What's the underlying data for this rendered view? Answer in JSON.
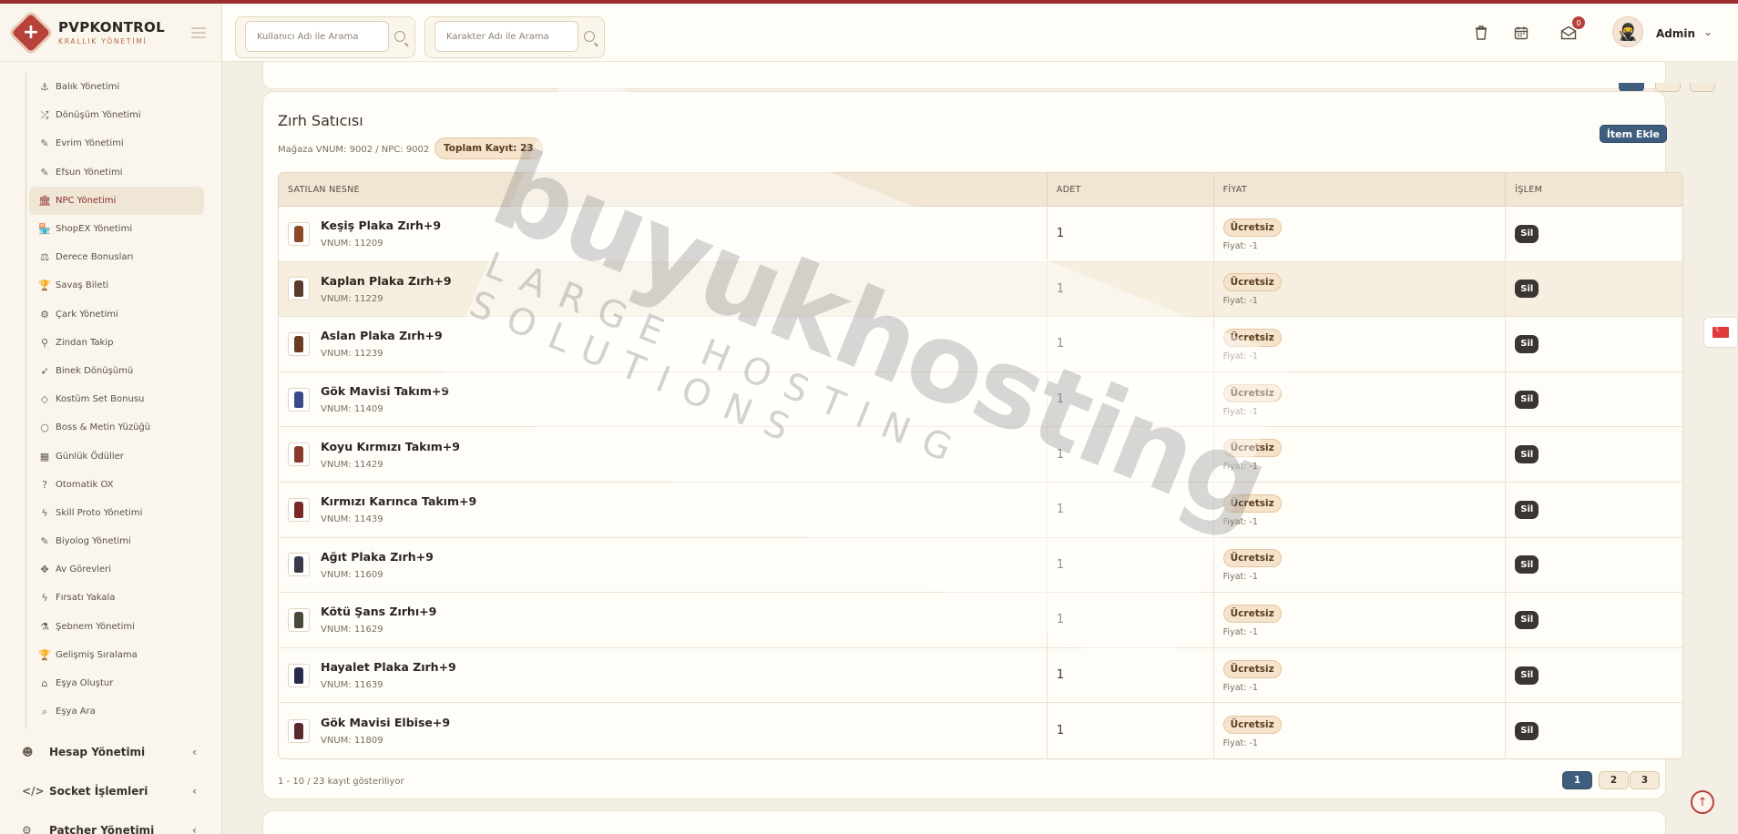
{
  "brand": {
    "title": "PVPKONTROL",
    "subtitle": "KRALLIK YÖNETİMİ"
  },
  "header": {
    "search_user_placeholder": "Kullanıcı Adı ile Arama",
    "search_char_placeholder": "Karakter Adı ile Arama",
    "notification_count": "0",
    "user_name": "Admin"
  },
  "sidebar": {
    "items": [
      {
        "label": "Balık Yönetimi",
        "icon": "anchor-icon"
      },
      {
        "label": "Dönüşüm Yönetimi",
        "icon": "shuffle-icon"
      },
      {
        "label": "Evrim Yönetimi",
        "icon": "wand-icon"
      },
      {
        "label": "Efsun Yönetimi",
        "icon": "wand-icon"
      },
      {
        "label": "NPC Yönetimi",
        "icon": "bank-icon",
        "active": true
      },
      {
        "label": "ShopEX Yönetimi",
        "icon": "shop-icon"
      },
      {
        "label": "Derece Bonusları",
        "icon": "scale-icon"
      },
      {
        "label": "Savaş Bileti",
        "icon": "trophy-icon"
      },
      {
        "label": "Çark Yönetimi",
        "icon": "wheel-icon"
      },
      {
        "label": "Zindan Takip",
        "icon": "pin-icon"
      },
      {
        "label": "Binek Dönüşümü",
        "icon": "rocket-icon"
      },
      {
        "label": "Kostüm Set Bonusu",
        "icon": "gem-icon"
      },
      {
        "label": "Boss & Metin Yüzüğü",
        "icon": "ring-icon"
      },
      {
        "label": "Günlük Ödüller",
        "icon": "calendar-icon"
      },
      {
        "label": "Otomatik OX",
        "icon": "question-icon"
      },
      {
        "label": "Skill Proto Yönetimi",
        "icon": "bolt-icon"
      },
      {
        "label": "Biyolog Yönetimi",
        "icon": "wand-icon"
      },
      {
        "label": "Av Görevleri",
        "icon": "crosshair-icon"
      },
      {
        "label": "Fırsatı Yakala",
        "icon": "bolt-icon"
      },
      {
        "label": "Şebnem Yönetimi",
        "icon": "flask-icon"
      },
      {
        "label": "Gelişmiş Sıralama",
        "icon": "trophy-icon"
      },
      {
        "label": "Eşya Oluştur",
        "icon": "gift-icon"
      },
      {
        "label": "Eşya Ara",
        "icon": "search-icon"
      }
    ],
    "groups": [
      {
        "label": "Hesap Yönetimi",
        "icon": "users-icon"
      },
      {
        "label": "Socket İşlemleri",
        "icon": "code-icon"
      },
      {
        "label": "Patcher Yönetimi",
        "icon": "cog-icon"
      }
    ]
  },
  "card": {
    "title": "Zırh Satıcısı",
    "meta": "Mağaza VNUM: 9002 / NPC: 9002",
    "total_badge": "Toplam Kayıt: 23",
    "add_button": "İtem Ekle",
    "columns": [
      "SATILAN NESNE",
      "ADET",
      "FİYAT",
      "İŞLEM"
    ],
    "rows": [
      {
        "name": "Keşiş Plaka Zırh+9",
        "vnum": "VNUM: 11209",
        "qty": "1",
        "price": "Ücretsiz",
        "price_sub": "Fiyat: -1",
        "action": "Sil",
        "color": "#8a4a2a"
      },
      {
        "name": "Kaplan Plaka Zırh+9",
        "vnum": "VNUM: 11229",
        "qty": "1",
        "price": "Ücretsiz",
        "price_sub": "Fiyat: -1",
        "action": "Sil",
        "color": "#5a3a2a"
      },
      {
        "name": "Aslan Plaka Zırh+9",
        "vnum": "VNUM: 11239",
        "qty": "1",
        "price": "Ücretsiz",
        "price_sub": "Fiyat: -1",
        "action": "Sil",
        "color": "#6a3a22"
      },
      {
        "name": "Gök Mavisi Takım+9",
        "vnum": "VNUM: 11409",
        "qty": "1",
        "price": "Ücretsiz",
        "price_sub": "Fiyat: -1",
        "action": "Sil",
        "color": "#3a4a8a"
      },
      {
        "name": "Koyu Kırmızı Takım+9",
        "vnum": "VNUM: 11429",
        "qty": "1",
        "price": "Ücretsiz",
        "price_sub": "Fiyat: -1",
        "action": "Sil",
        "color": "#8a3a2a"
      },
      {
        "name": "Kırmızı Karınca Takım+9",
        "vnum": "VNUM: 11439",
        "qty": "1",
        "price": "Ücretsiz",
        "price_sub": "Fiyat: -1",
        "action": "Sil",
        "color": "#7a2a22"
      },
      {
        "name": "Ağıt Plaka Zırh+9",
        "vnum": "VNUM: 11609",
        "qty": "1",
        "price": "Ücretsiz",
        "price_sub": "Fiyat: -1",
        "action": "Sil",
        "color": "#3a3a4a"
      },
      {
        "name": "Kötü Şans Zırhı+9",
        "vnum": "VNUM: 11629",
        "qty": "1",
        "price": "Ücretsiz",
        "price_sub": "Fiyat: -1",
        "action": "Sil",
        "color": "#4a4a3a"
      },
      {
        "name": "Hayalet Plaka Zırh+9",
        "vnum": "VNUM: 11639",
        "qty": "1",
        "price": "Ücretsiz",
        "price_sub": "Fiyat: -1",
        "action": "Sil",
        "color": "#2a2a4a"
      },
      {
        "name": "Gök Mavisi Elbise+9",
        "vnum": "VNUM: 11809",
        "qty": "1",
        "price": "Ücretsiz",
        "price_sub": "Fiyat: -1",
        "action": "Sil",
        "color": "#5a2a2a"
      }
    ],
    "footer_info": "1 - 10 / 23 kayıt gösteriliyor",
    "pages": [
      "1",
      "2",
      "3"
    ]
  },
  "watermark": {
    "big": "buyukhosting",
    "small": "LARGE HOSTING SOLUTIONS"
  }
}
